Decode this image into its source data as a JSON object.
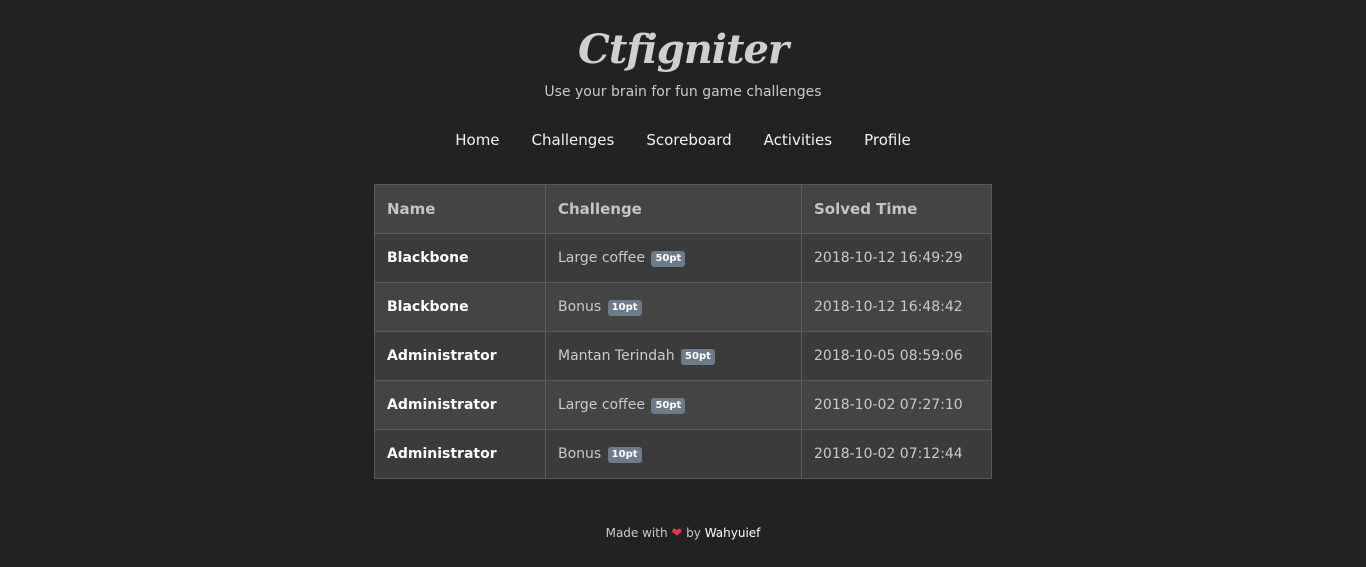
{
  "header": {
    "title": "Ctfigniter",
    "tagline": "Use your brain for fun game challenges"
  },
  "nav": {
    "items": [
      {
        "label": "Home"
      },
      {
        "label": "Challenges"
      },
      {
        "label": "Scoreboard"
      },
      {
        "label": "Activities"
      },
      {
        "label": "Profile"
      }
    ]
  },
  "table": {
    "headers": [
      "Name",
      "Challenge",
      "Solved Time"
    ],
    "rows": [
      {
        "name": "Blackbone",
        "challenge": "Large coffee",
        "points": "50pt",
        "time": "2018-10-12 16:49:29"
      },
      {
        "name": "Blackbone",
        "challenge": "Bonus",
        "points": "10pt",
        "time": "2018-10-12 16:48:42"
      },
      {
        "name": "Administrator",
        "challenge": "Mantan Terindah",
        "points": "50pt",
        "time": "2018-10-05 08:59:06"
      },
      {
        "name": "Administrator",
        "challenge": "Large coffee",
        "points": "50pt",
        "time": "2018-10-02 07:27:10"
      },
      {
        "name": "Administrator",
        "challenge": "Bonus",
        "points": "10pt",
        "time": "2018-10-02 07:12:44"
      }
    ]
  },
  "footer": {
    "prefix": "Made with",
    "heart_icon": "heart-icon",
    "by": "by",
    "author": "Wahyuief"
  },
  "colors": {
    "background": "#222222",
    "badge": "#6c7a89",
    "heart": "#e0344a"
  }
}
